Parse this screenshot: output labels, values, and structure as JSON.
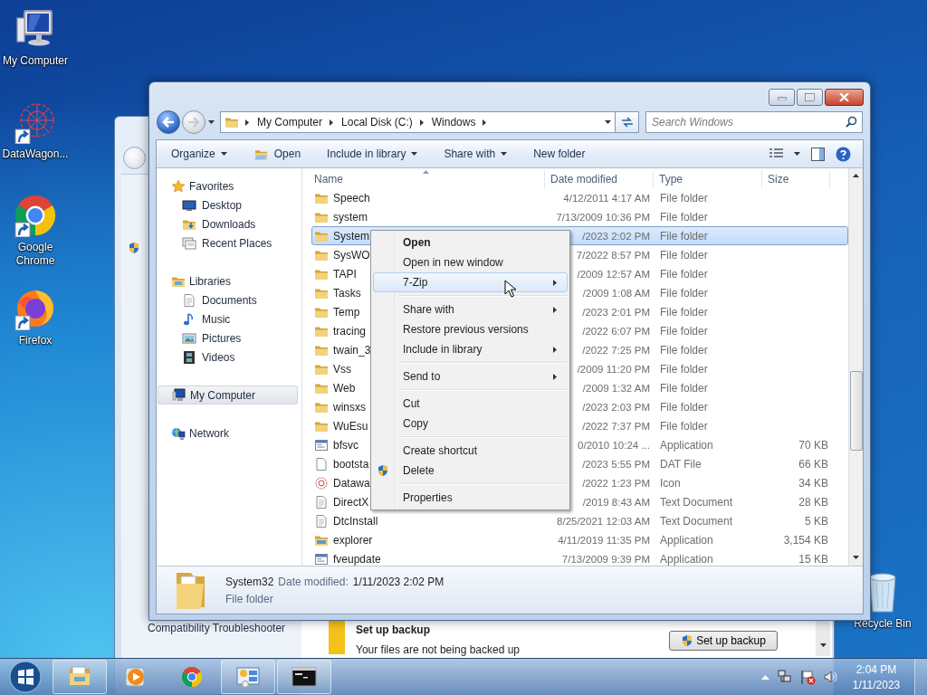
{
  "desktop_icons": [
    {
      "label": "My Computer",
      "kind": "computer",
      "shortcut": false
    },
    {
      "label": "DataWagon...",
      "kind": "datawagon",
      "shortcut": true
    },
    {
      "label": "Google Chrome",
      "kind": "chrome",
      "shortcut": true
    },
    {
      "label": "Firefox",
      "kind": "firefox",
      "shortcut": true
    }
  ],
  "recycle_bin": {
    "label": "Recycle Bin"
  },
  "back_window": {
    "troubleshooter_link": "Compatibility Troubleshooter",
    "backup": {
      "title": "Set up backup",
      "message": "Your files are not being backed up",
      "button": "Set up backup"
    }
  },
  "explorer": {
    "breadcrumbs": [
      "My Computer",
      "Local Disk (C:)",
      "Windows"
    ],
    "search": {
      "placeholder": "Search Windows"
    },
    "toolbar": [
      {
        "label": "Organize",
        "kind": "plain",
        "dropdown": true
      },
      {
        "label": "Open",
        "kind": "open",
        "dropdown": false
      },
      {
        "label": "Include in library",
        "kind": "plain",
        "dropdown": true
      },
      {
        "label": "Share with",
        "kind": "plain",
        "dropdown": true
      },
      {
        "label": "New folder",
        "kind": "plain",
        "dropdown": false
      }
    ],
    "sidebar": [
      {
        "label": "Favorites",
        "kind": "star",
        "selected": false,
        "children": [
          {
            "label": "Desktop",
            "kind": "desktop",
            "selected": false
          },
          {
            "label": "Downloads",
            "kind": "downloads",
            "selected": false
          },
          {
            "label": "Recent Places",
            "kind": "recent",
            "selected": false
          }
        ]
      },
      {
        "label": "Libraries",
        "kind": "libraries",
        "selected": false,
        "children": [
          {
            "label": "Documents",
            "kind": "documents",
            "selected": false
          },
          {
            "label": "Music",
            "kind": "music",
            "selected": false
          },
          {
            "label": "Pictures",
            "kind": "pictures",
            "selected": false
          },
          {
            "label": "Videos",
            "kind": "videos",
            "selected": false
          }
        ]
      },
      {
        "label": "My Computer",
        "kind": "computer",
        "selected": true
      },
      {
        "label": "Network",
        "kind": "network",
        "selected": false
      }
    ],
    "columns": [
      "Name",
      "Date modified",
      "Type",
      "Size"
    ],
    "rows": [
      {
        "kind": "folder",
        "name": "Speech",
        "date": "4/12/2011 4:17 AM",
        "type": "File folder",
        "selected": false
      },
      {
        "kind": "folder",
        "name": "system",
        "date": "7/13/2009 10:36 PM",
        "type": "File folder",
        "selected": false
      },
      {
        "kind": "folder",
        "name": "System",
        "date": "/2023 2:02 PM",
        "type": "File folder",
        "selected": true
      },
      {
        "kind": "folder",
        "name": "SysWO",
        "date": "7/2022 8:57 PM",
        "type": "File folder",
        "selected": false
      },
      {
        "kind": "folder",
        "name": "TAPI",
        "date": "/2009 12:57 AM",
        "type": "File folder",
        "selected": false
      },
      {
        "kind": "folder",
        "name": "Tasks",
        "date": "/2009 1:08 AM",
        "type": "File folder",
        "selected": false
      },
      {
        "kind": "folder",
        "name": "Temp",
        "date": "/2023 2:01 PM",
        "type": "File folder",
        "selected": false
      },
      {
        "kind": "folder",
        "name": "tracing",
        "date": "/2022 6:07 PM",
        "type": "File folder",
        "selected": false
      },
      {
        "kind": "folder",
        "name": "twain_3",
        "date": "/2022 7:25 PM",
        "type": "File folder",
        "selected": false
      },
      {
        "kind": "folder",
        "name": "Vss",
        "date": "/2009 11:20 PM",
        "type": "File folder",
        "selected": false
      },
      {
        "kind": "folder",
        "name": "Web",
        "date": "/2009 1:32 AM",
        "type": "File folder",
        "selected": false
      },
      {
        "kind": "folder",
        "name": "winsxs",
        "date": "/2023 2:03 PM",
        "type": "File folder",
        "selected": false
      },
      {
        "kind": "folder",
        "name": "WuEsu",
        "date": "/2022 7:37 PM",
        "type": "File folder",
        "selected": false
      },
      {
        "kind": "application",
        "name": "bfsvc",
        "date": "0/2010 10:24 ...",
        "type": "Application",
        "size": "70 KB",
        "selected": false
      },
      {
        "kind": "file",
        "name": "bootsta",
        "date": "/2023 5:55 PM",
        "type": "DAT File",
        "size": "66 KB",
        "selected": false
      },
      {
        "kind": "pattern",
        "name": "Datawa",
        "date": "/2022 1:23 PM",
        "type": "Icon",
        "size": "34 KB",
        "selected": false
      },
      {
        "kind": "text",
        "name": "DirectX",
        "date": "/2019 8:43 AM",
        "type": "Text Document",
        "size": "28 KB",
        "selected": false
      },
      {
        "kind": "text",
        "name": "DtcInstall",
        "date": "8/25/2021 12:03 AM",
        "type": "Text Document",
        "size": "5 KB",
        "selected": false
      },
      {
        "kind": "explorer",
        "name": "explorer",
        "date": "4/11/2019 11:35 PM",
        "type": "Application",
        "size": "3,154 KB",
        "selected": false
      },
      {
        "kind": "application",
        "name": "fveupdate",
        "date": "7/13/2009 9:39 PM",
        "type": "Application",
        "size": "15 KB",
        "selected": false
      }
    ],
    "details": {
      "name": "System32",
      "date_label": "Date modified:",
      "date": "1/11/2023 2:02 PM",
      "type": "File folder"
    }
  },
  "context_menu": [
    {
      "kind": "item",
      "label": "Open",
      "default": true,
      "selected": false,
      "submenu": false,
      "shield": false
    },
    {
      "kind": "item",
      "label": "Open in new window",
      "default": false,
      "selected": false,
      "submenu": false,
      "shield": false
    },
    {
      "kind": "item",
      "label": "7-Zip",
      "default": false,
      "selected": true,
      "submenu": true,
      "shield": false
    },
    {
      "kind": "separator"
    },
    {
      "kind": "item",
      "label": "Share with",
      "default": false,
      "selected": false,
      "submenu": true,
      "shield": false
    },
    {
      "kind": "item",
      "label": "Restore previous versions",
      "default": false,
      "selected": false,
      "submenu": false,
      "shield": false
    },
    {
      "kind": "item",
      "label": "Include in library",
      "default": false,
      "selected": false,
      "submenu": true,
      "shield": false
    },
    {
      "kind": "separator"
    },
    {
      "kind": "item",
      "label": "Send to",
      "default": false,
      "selected": false,
      "submenu": true,
      "shield": false
    },
    {
      "kind": "separator"
    },
    {
      "kind": "item",
      "label": "Cut",
      "default": false,
      "selected": false,
      "submenu": false,
      "shield": false
    },
    {
      "kind": "item",
      "label": "Copy",
      "default": false,
      "selected": false,
      "submenu": false,
      "shield": false
    },
    {
      "kind": "separator"
    },
    {
      "kind": "item",
      "label": "Create shortcut",
      "default": false,
      "selected": false,
      "submenu": false,
      "shield": false
    },
    {
      "kind": "item",
      "label": "Delete",
      "default": false,
      "selected": false,
      "submenu": false,
      "shield": true
    },
    {
      "kind": "separator"
    },
    {
      "kind": "item",
      "label": "Properties",
      "default": false,
      "selected": false,
      "submenu": false,
      "shield": false
    }
  ],
  "taskbar": {
    "buttons": [
      {
        "kind": "explorer",
        "running": true
      },
      {
        "kind": "media",
        "running": false
      },
      {
        "kind": "chrome",
        "running": false
      },
      {
        "kind": "control-panel",
        "running": true
      },
      {
        "kind": "cmd",
        "running": true
      }
    ],
    "clock": {
      "time": "2:04 PM",
      "date": "1/11/2023"
    }
  }
}
